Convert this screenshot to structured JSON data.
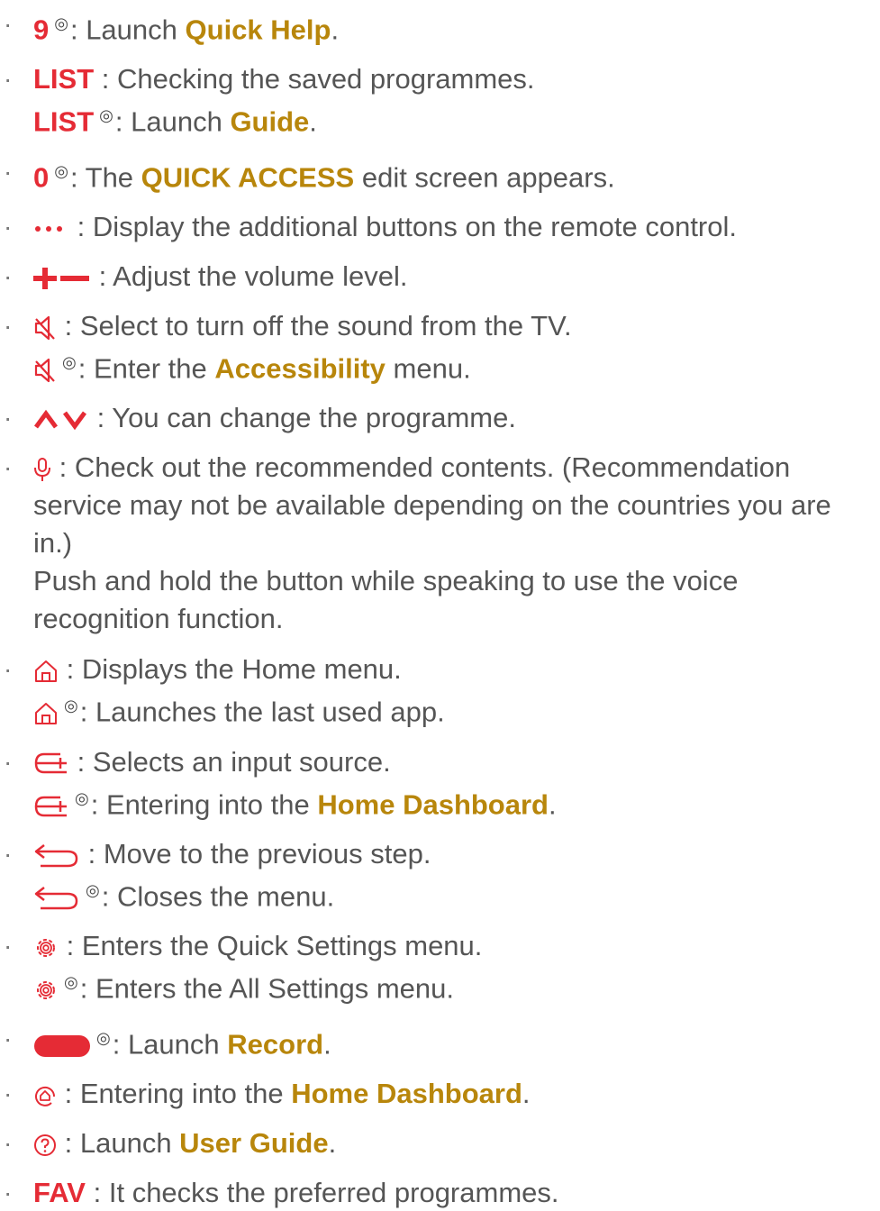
{
  "items": [
    {
      "bullet": "·",
      "key": "9",
      "sep": ": Launch ",
      "target": "Quick Help",
      "end": "."
    },
    {
      "bullet": "·",
      "key": "LIST",
      "text": ": Checking the saved programmes.",
      "key2": "LIST",
      "sep2": ": Launch ",
      "target2": "Guide",
      "end2": "."
    },
    {
      "bullet": "·",
      "key": "0",
      "sep": ": The ",
      "target": "QUICK ACCESS",
      "text": " edit screen appears."
    },
    {
      "bullet": "·",
      "icon": "more-dots-icon",
      "text": ": Display the additional buttons on the remote control."
    },
    {
      "bullet": "·",
      "icon": "volume-plus-minus-icon",
      "text": ": Adjust the volume level."
    },
    {
      "bullet": "·",
      "icon": "mute-icon",
      "text": ": Select to turn off the sound from the TV.",
      "sep2": ": Enter the ",
      "target2": "Accessibility",
      "text2": " menu."
    },
    {
      "bullet": "·",
      "icon": "channel-up-down-icon",
      "text": ": You can change the programme."
    },
    {
      "bullet": "·",
      "icon": "microphone-icon",
      "text": ": Check out the recommended contents. (Recommendation service may not be available depending on the countries you are in.)",
      "text2": "Push and hold the button while speaking to use the voice recognition function."
    },
    {
      "bullet": "·",
      "icon": "home-icon",
      "text": ": Displays the Home menu.",
      "text2": ": Launches the last used app."
    },
    {
      "bullet": "·",
      "icon": "input-source-icon",
      "text": ": Selects an input source.",
      "sep2": ": Entering into the ",
      "target2": "Home Dashboard",
      "end2": "."
    },
    {
      "bullet": "·",
      "icon": "back-icon",
      "text": ": Move to the previous step.",
      "text2": ": Closes the menu."
    },
    {
      "bullet": "·",
      "icon": "settings-icon",
      "text": ": Enters the Quick Settings menu.",
      "text2": ": Enters the All Settings menu."
    },
    {
      "bullet": "·",
      "icon": "record-button-icon",
      "sep": ": Launch ",
      "target": "Record",
      "end": "."
    },
    {
      "bullet": "·",
      "icon": "home-dashboard-icon",
      "sep": ": Entering into the ",
      "target": "Home Dashboard",
      "end": "."
    },
    {
      "bullet": "·",
      "icon": "user-guide-icon",
      "sep": ": Launch ",
      "target": "User Guide",
      "end": "."
    },
    {
      "bullet": "·",
      "key": "FAV",
      "text": ": It checks the preferred programmes."
    }
  ],
  "long_press_symbol": "◎",
  "colors": {
    "key": "#e52b35",
    "highlight": "#b8860b",
    "text": "#555555"
  }
}
